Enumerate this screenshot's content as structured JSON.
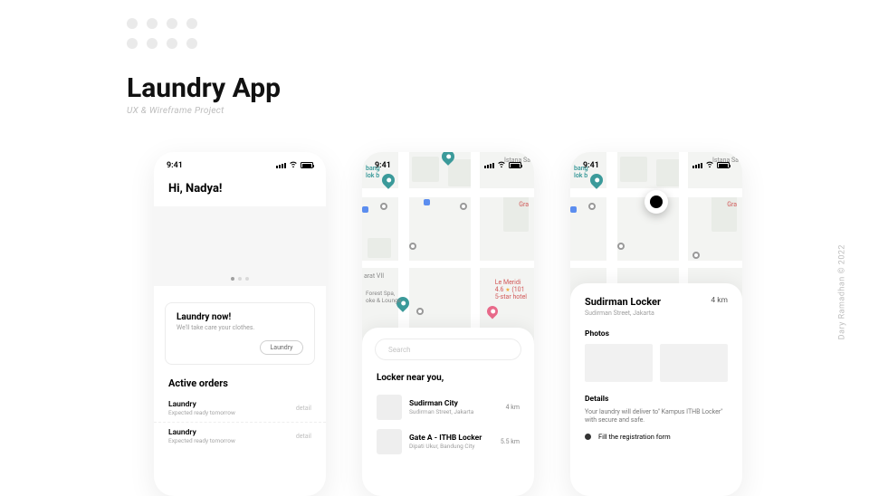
{
  "page": {
    "title": "Laundry App",
    "subtitle": "UX & Wireframe Project",
    "credit": "Dary Ramadhan © 2022"
  },
  "status": {
    "time": "9:41"
  },
  "screen1": {
    "greeting": "Hi, Nadya!",
    "card": {
      "title": "Laundry now!",
      "subtitle": "We'll take care your clothes.",
      "button": "Laundry"
    },
    "activeTitle": "Active orders",
    "orders": [
      {
        "title": "Laundry",
        "subtitle": "Expected ready tomorrow",
        "action": "detail"
      },
      {
        "title": "Laundry",
        "subtitle": "Expected ready tomorrow",
        "action": "detail"
      }
    ]
  },
  "screen2": {
    "searchPlaceholder": "Search",
    "heading": "Locker near you,",
    "lockers": [
      {
        "name": "Sudirman City",
        "addr": "Sudirman Street, Jakarta",
        "dist": "4 km"
      },
      {
        "name": "Gate A - ITHB Locker",
        "addr": "Dipati Ukur, Bandung City",
        "dist": "5.5 km"
      }
    ]
  },
  "screen3": {
    "name": "Sudirman Locker",
    "addr": "Sudirman Street, Jakarta",
    "dist": "4 km",
    "photosLabel": "Photos",
    "detailsLabel": "Details",
    "detailsText": "Your laundry will deliver to\" Kampus ITHB Locker\" with secure and safe.",
    "step1": "Fill the registration form"
  },
  "map": {
    "istana": "Istana Sa",
    "blok": "bang\nlok b",
    "arat": "arat VII",
    "meridien": "Le Meridi",
    "meridienSub": "4.6",
    "meridienSub2": "5-star hotel",
    "spa": "Forest Spa,\noke & Lounge",
    "gra": "Gra"
  }
}
